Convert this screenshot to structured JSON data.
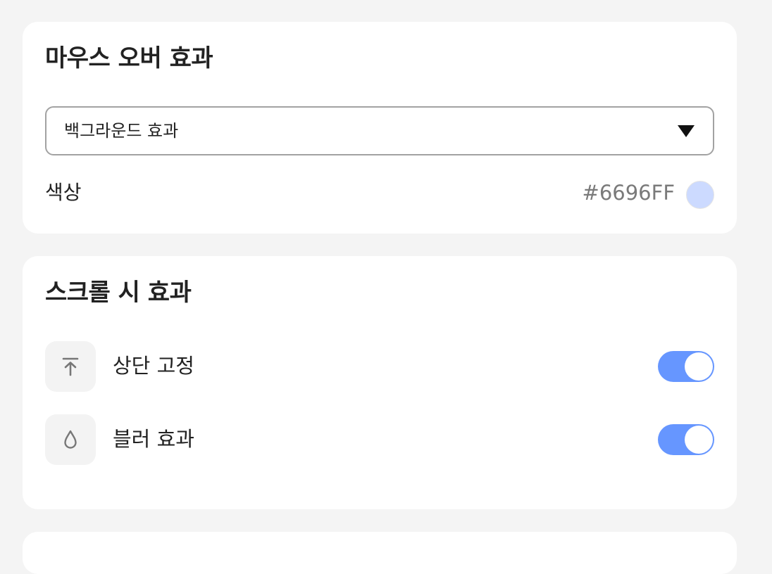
{
  "colors": {
    "accent": "#6696FF",
    "swatch": "#CCDAFF",
    "background": "#F4F4F4",
    "card": "#FFFFFF"
  },
  "hover_card": {
    "title": "마우스 오버 효과",
    "effect_select": {
      "value": "백그라운드 효과",
      "icon": "caret-down-icon"
    },
    "color": {
      "label": "색상",
      "hex": "#6696FF"
    }
  },
  "scroll_card": {
    "title": "스크롤 시 효과",
    "items": [
      {
        "label": "상단 고정",
        "icon": "arrow-up-to-line-icon",
        "enabled": true
      },
      {
        "label": "블러 효과",
        "icon": "droplet-icon",
        "enabled": true
      }
    ]
  }
}
